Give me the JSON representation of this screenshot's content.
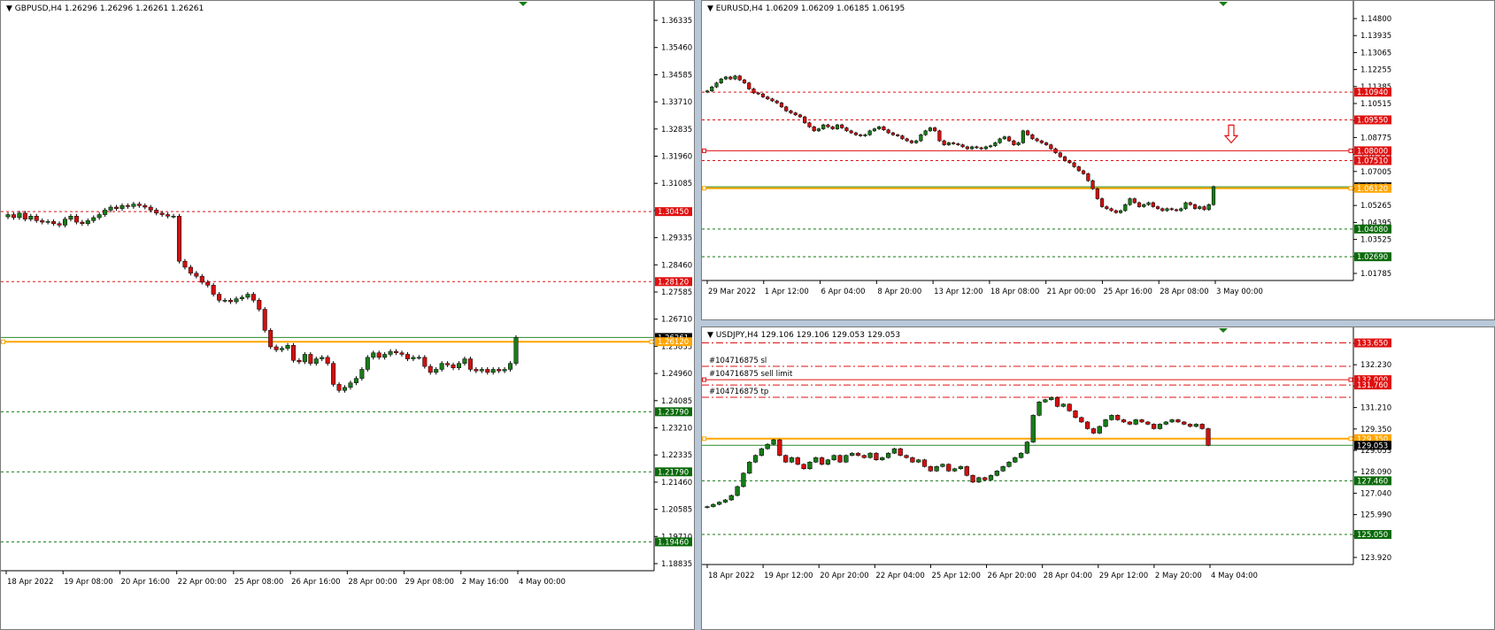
{
  "colors": {
    "bull": "#1a7a1a",
    "bear": "#d01010",
    "resist": "#e01010",
    "support": "#147a14",
    "orange": "#ffa500",
    "axis": "#000000",
    "grid_text": "#000000"
  },
  "charts": [
    {
      "id": "gbpusd",
      "header": "GBPUSD,H4  1.26296 1.26296 1.26261 1.26261",
      "ylim": [
        1.185,
        1.3705
      ],
      "yticks": [
        "1.36335",
        "1.35460",
        "1.34585",
        "1.33710",
        "1.32835",
        "1.31960",
        "1.31085",
        "1.30210",
        "1.29335",
        "1.28460",
        "1.27585",
        "1.26710",
        "1.25835",
        "1.24960",
        "1.24085",
        "1.23210",
        "1.22335",
        "1.21460",
        "1.20585",
        "1.19710",
        "1.18835"
      ],
      "xticks": [
        "18 Apr 2022",
        "19 Apr 08:00",
        "20 Apr 16:00",
        "22 Apr 00:00",
        "25 Apr 08:00",
        "26 Apr 16:00",
        "28 Apr 00:00",
        "29 Apr 08:00",
        "2 May 16:00",
        "4 May 00:00"
      ],
      "levels": [
        {
          "price": 1.3045,
          "label": "1.30450",
          "kind": "resist",
          "style": "dash"
        },
        {
          "price": 1.2812,
          "label": "1.28120",
          "kind": "resist",
          "style": "dash"
        },
        {
          "price": 1.26261,
          "label": "1.26261",
          "kind": "current",
          "style": "solid"
        },
        {
          "price": 1.2612,
          "label": "1.26120",
          "kind": "orange",
          "style": "solid"
        },
        {
          "price": 1.2379,
          "label": "1.23790",
          "kind": "support",
          "style": "dash"
        },
        {
          "price": 1.2179,
          "label": "1.21790",
          "kind": "support",
          "style": "dash"
        },
        {
          "price": 1.1946,
          "label": "1.19460",
          "kind": "support",
          "style": "dash"
        }
      ],
      "closes": [
        1.3035,
        1.3025,
        1.304,
        1.302,
        1.303,
        1.3015,
        1.301,
        1.3012,
        1.3005,
        1.3,
        1.302,
        1.303,
        1.301,
        1.3005,
        1.3015,
        1.3025,
        1.3035,
        1.305,
        1.306,
        1.3055,
        1.3065,
        1.3062,
        1.307,
        1.3065,
        1.306,
        1.305,
        1.304,
        1.3035,
        1.303,
        1.303,
        1.288,
        1.286,
        1.284,
        1.283,
        1.281,
        1.28,
        1.277,
        1.275,
        1.275,
        1.2745,
        1.2755,
        1.276,
        1.277,
        1.275,
        1.272,
        1.265,
        1.2595,
        1.2585,
        1.259,
        1.26,
        1.255,
        1.2545,
        1.257,
        1.254,
        1.2555,
        1.256,
        1.254,
        1.247,
        1.245,
        1.246,
        1.2475,
        1.249,
        1.252,
        1.256,
        1.2575,
        1.256,
        1.257,
        1.258,
        1.2575,
        1.257,
        1.2555,
        1.256,
        1.256,
        1.253,
        1.251,
        1.252,
        1.254,
        1.2535,
        1.2525,
        1.254,
        1.2555,
        1.252,
        1.2515,
        1.252,
        1.251,
        1.252,
        1.2515,
        1.252,
        1.254,
        1.2626
      ]
    },
    {
      "id": "eurusd",
      "header": "EURUSD,H4  1.06209 1.06209 1.06185 1.06195",
      "ylim": [
        1.015,
        1.1498
      ],
      "yticks": [
        "1.14800",
        "1.13935",
        "1.13065",
        "1.12255",
        "1.11385",
        "1.10515",
        "1.09645",
        "1.08775",
        "1.07955",
        "1.07005",
        "1.06135",
        "1.05265",
        "1.04395",
        "1.03525",
        "1.02655",
        "1.01785"
      ],
      "xticks": [
        "29 Mar 2022",
        "1 Apr 12:00",
        "6 Apr 04:00",
        "8 Apr 20:00",
        "13 Apr 12:00",
        "18 Apr 08:00",
        "21 Apr 00:00",
        "25 Apr 16:00",
        "28 Apr 08:00",
        "3 May 00:00"
      ],
      "levels": [
        {
          "price": 1.1094,
          "label": "1.10940",
          "kind": "resist",
          "style": "dash"
        },
        {
          "price": 1.0955,
          "label": "1.09550",
          "kind": "resist",
          "style": "dash"
        },
        {
          "price": 1.08,
          "label": "1.08000",
          "kind": "resist",
          "style": "solid"
        },
        {
          "price": 1.0751,
          "label": "1.07510",
          "kind": "resist",
          "style": "dash"
        },
        {
          "price": 1.06195,
          "label": "1.06195",
          "kind": "current",
          "style": "solid"
        },
        {
          "price": 1.0612,
          "label": "1.06120",
          "kind": "orange",
          "style": "solid"
        },
        {
          "price": 1.0408,
          "label": "1.04080",
          "kind": "support",
          "style": "dash"
        },
        {
          "price": 1.0269,
          "label": "1.02690",
          "kind": "support",
          "style": "dash"
        }
      ],
      "closes": [
        1.11,
        1.112,
        1.114,
        1.116,
        1.117,
        1.116,
        1.1175,
        1.1155,
        1.114,
        1.111,
        1.109,
        1.1085,
        1.107,
        1.106,
        1.105,
        1.104,
        1.102,
        1.1,
        1.099,
        1.098,
        1.097,
        1.094,
        1.092,
        1.09,
        1.091,
        1.093,
        1.092,
        1.091,
        1.093,
        1.0915,
        1.09,
        1.089,
        1.088,
        1.0875,
        1.088,
        1.09,
        1.091,
        1.092,
        1.0905,
        1.089,
        1.088,
        1.0875,
        1.086,
        1.085,
        1.084,
        1.085,
        1.088,
        1.09,
        1.0915,
        1.09,
        1.085,
        1.083,
        1.084,
        1.0835,
        1.083,
        1.082,
        1.081,
        1.082,
        1.0815,
        1.081,
        1.082,
        1.0825,
        1.084,
        1.086,
        1.087,
        1.085,
        1.083,
        1.084,
        1.09,
        1.088,
        1.086,
        1.085,
        1.084,
        1.083,
        1.081,
        1.079,
        1.077,
        1.075,
        1.074,
        1.072,
        1.07,
        1.0685,
        1.065,
        1.061,
        1.056,
        1.052,
        1.051,
        1.05,
        1.049,
        1.05,
        1.053,
        1.056,
        1.054,
        1.052,
        1.053,
        1.054,
        1.052,
        1.051,
        1.05,
        1.051,
        1.0505,
        1.05,
        1.051,
        1.054,
        1.053,
        1.051,
        1.052,
        1.0505,
        1.053,
        1.062
      ],
      "arrow": {
        "price": 1.084,
        "color": "#e01010"
      }
    },
    {
      "id": "usdjpy",
      "header": "USDJPY,H4  129.106 129.106 129.053 129.053",
      "ylim": [
        123.7,
        133.95
      ],
      "yticks": [
        "133.650",
        "132.230",
        "131.760",
        "131.210",
        "129.350",
        "129.053",
        "128.090",
        "127.040",
        "125.990",
        "124.940",
        "123.920"
      ],
      "xticks": [
        "18 Apr 2022",
        "19 Apr 12:00",
        "20 Apr 20:00",
        "22 Apr 04:00",
        "25 Apr 12:00",
        "26 Apr 20:00",
        "28 Apr 04:00",
        "29 Apr 12:00",
        "2 May 20:00",
        "4 May 04:00"
      ],
      "levels": [
        {
          "price": 133.65,
          "label": "133.650",
          "kind": "resist",
          "style": "dashdot"
        },
        {
          "price": 132.6,
          "label": "",
          "kind": "resist",
          "style": "dashdot"
        },
        {
          "price": 132.0,
          "label": "132.000",
          "kind": "resist",
          "style": "solid"
        },
        {
          "price": 131.76,
          "label": "131.760",
          "kind": "resist",
          "style": "dashdot"
        },
        {
          "price": 131.21,
          "label": "",
          "kind": "resist",
          "style": "dashdot"
        },
        {
          "price": 129.35,
          "label": "129.350",
          "kind": "orange",
          "style": "solid"
        },
        {
          "price": 129.053,
          "label": "129.053",
          "kind": "current",
          "style": "solid"
        },
        {
          "price": 127.46,
          "label": "127.460",
          "kind": "support",
          "style": "dash"
        },
        {
          "price": 125.05,
          "label": "125.050",
          "kind": "support",
          "style": "dash"
        }
      ],
      "annotations": [
        {
          "price": 132.6,
          "text": "#104716875 sl"
        },
        {
          "price": 132.0,
          "text": "#104716875 sell limit"
        },
        {
          "price": 131.21,
          "text": "#104716875 tp"
        }
      ],
      "closes": [
        126.3,
        126.4,
        126.5,
        126.6,
        126.8,
        127.2,
        127.8,
        128.3,
        128.6,
        128.9,
        129.1,
        129.3,
        128.6,
        128.3,
        128.5,
        128.2,
        128.0,
        128.3,
        128.5,
        128.2,
        128.4,
        128.6,
        128.3,
        128.6,
        128.7,
        128.6,
        128.5,
        128.7,
        128.4,
        128.5,
        128.7,
        128.9,
        128.6,
        128.5,
        128.3,
        128.4,
        128.1,
        127.9,
        128.1,
        128.2,
        127.9,
        128.0,
        128.1,
        127.7,
        127.4,
        127.6,
        127.5,
        127.7,
        127.9,
        128.1,
        128.3,
        128.5,
        128.7,
        129.2,
        130.4,
        131.0,
        131.1,
        131.2,
        130.8,
        130.9,
        130.6,
        130.3,
        130.1,
        129.8,
        129.6,
        129.9,
        130.2,
        130.4,
        130.2,
        130.1,
        130.0,
        130.2,
        130.1,
        130.0,
        129.8,
        130.0,
        130.1,
        130.2,
        130.1,
        130.0,
        129.9,
        130.0,
        129.8,
        129.053
      ]
    }
  ]
}
